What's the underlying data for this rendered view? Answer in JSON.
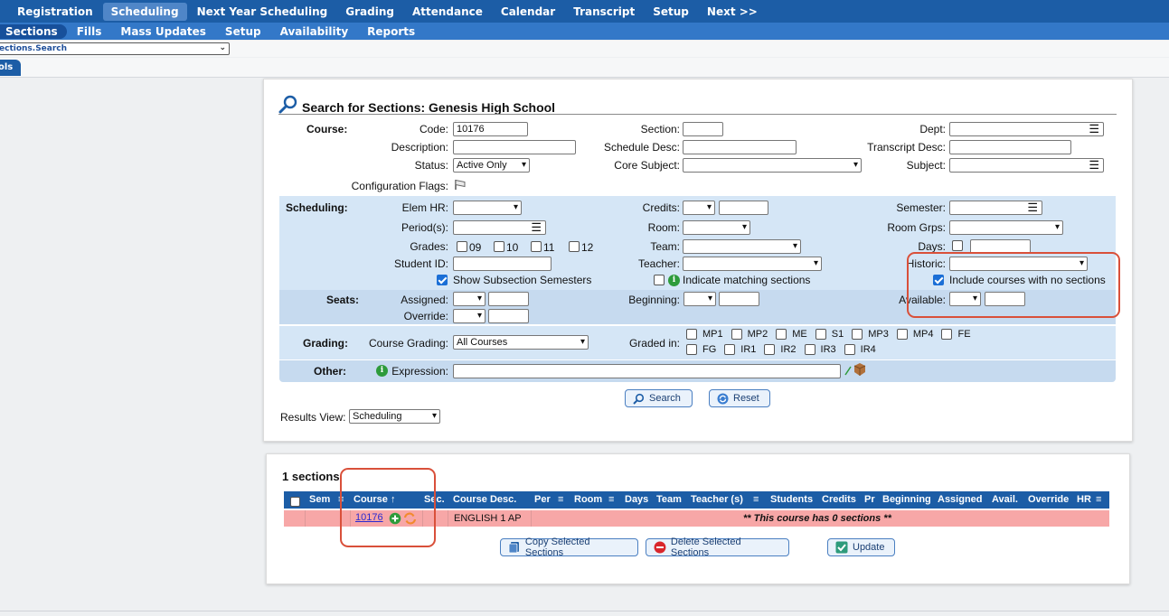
{
  "top_nav": [
    "Registration",
    "Scheduling",
    "Next Year Scheduling",
    "Grading",
    "Attendance",
    "Calendar",
    "Transcript",
    "Setup",
    "Next >>"
  ],
  "sub_nav": [
    "Sections",
    "Fills",
    "Mass Updates",
    "Setup",
    "Availability",
    "Reports"
  ],
  "page_select": "ections.Search",
  "left_tab": "ols",
  "search": {
    "title": "Search for Sections: Genesis High School",
    "course_label": "Course:",
    "code_label": "Code:",
    "code_value": "10176",
    "section_label": "Section:",
    "dept_label": "Dept:",
    "description_label": "Description:",
    "schedule_desc_label": "Schedule Desc:",
    "transcript_desc_label": "Transcript Desc:",
    "status_label": "Status:",
    "status_value": "Active Only",
    "core_subject_label": "Core Subject:",
    "subject_label": "Subject:",
    "config_flags_label": "Configuration Flags:",
    "scheduling_label": "Scheduling:",
    "elem_hr_label": "Elem HR:",
    "credits_label": "Credits:",
    "semester_label": "Semester:",
    "periods_label": "Period(s):",
    "room_label": "Room:",
    "room_grps_label": "Room Grps:",
    "grades_label": "Grades:",
    "grades": [
      "09",
      "10",
      "11",
      "12"
    ],
    "team_label": "Team:",
    "days_label": "Days:",
    "student_id_label": "Student ID:",
    "teacher_label": "Teacher:",
    "historic_label": "Historic:",
    "show_subsection": "Show Subsection Semesters",
    "indicate_matching": "Indicate matching sections",
    "include_no_sections": "Include courses with no sections",
    "seats_label": "Seats:",
    "assigned_label": "Assigned:",
    "beginning_label": "Beginning:",
    "available_label": "Available:",
    "override_label": "Override:",
    "grading_label": "Grading:",
    "course_grading_label": "Course Grading:",
    "course_grading_value": "All Courses",
    "graded_in_label": "Graded in:",
    "graded_in_row1": [
      "MP1",
      "MP2",
      "ME",
      "S1",
      "MP3",
      "MP4",
      "FE"
    ],
    "graded_in_row2": [
      "FG",
      "IR1",
      "IR2",
      "IR3",
      "IR4"
    ],
    "other_label": "Other:",
    "expression_label": "Expression:",
    "search_button": "Search",
    "reset_button": "Reset",
    "results_view_label": "Results View:",
    "results_view_value": "Scheduling"
  },
  "results": {
    "count_label": "1 sections",
    "headers": {
      "sem": "Sem",
      "course": "Course ↑",
      "sec": "Sec.",
      "course_desc": "Course Desc.",
      "per": "Per",
      "room": "Room",
      "days": "Days",
      "team": "Team",
      "teacher": "Teacher (s)",
      "students": "Students",
      "credits": "Credits",
      "pr": "Pr",
      "beginning": "Beginning",
      "assigned": "Assigned",
      "avail": "Avail.",
      "override": "Override",
      "hr": "HR"
    },
    "row": {
      "course": "10176",
      "course_desc": "ENGLISH 1 AP",
      "message": "** This course has 0 sections **"
    },
    "copy_button": "Copy Selected Sections",
    "delete_button": "Delete Selected Sections",
    "update_button": "Update"
  },
  "colors": {
    "nav_blue": "#1c5da6",
    "band_blue": "#d5e6f6",
    "row_pink": "#f7a7a7",
    "highlight": "#d9503a"
  }
}
